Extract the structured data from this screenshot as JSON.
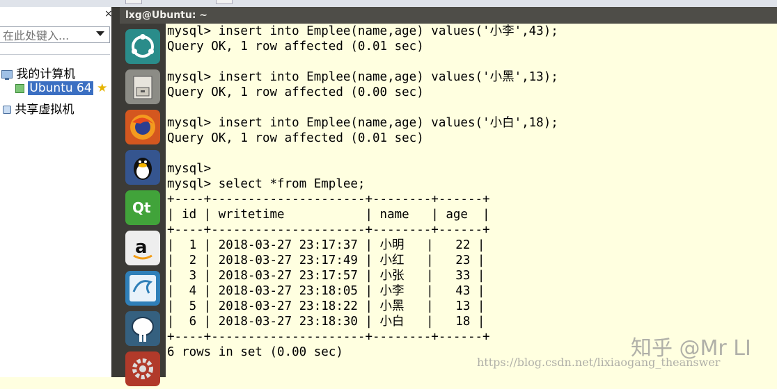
{
  "vm_library": {
    "close_glyph": "×",
    "search_placeholder": "在此处键入...",
    "tree": [
      {
        "label": "我的计算机"
      },
      {
        "label": "Ubuntu 64"
      },
      {
        "label": "共享虚拟机"
      }
    ]
  },
  "terminal": {
    "title": "lxg@Ubuntu: ~",
    "lines": [
      "mysql> insert into Emplee(name,age) values('小李',43);",
      "Query OK, 1 row affected (0.01 sec)",
      "",
      "mysql> insert into Emplee(name,age) values('小黑',13);",
      "Query OK, 1 row affected (0.00 sec)",
      "",
      "mysql> insert into Emplee(name,age) values('小白',18);",
      "Query OK, 1 row affected (0.01 sec)",
      "",
      "mysql>",
      "mysql> select *from Emplee;",
      "+----+---------------------+--------+------+",
      "| id | writetime           | name   | age  |",
      "+----+---------------------+--------+------+",
      "|  1 | 2018-03-27 23:17:37 | 小明   |   22 |",
      "|  2 | 2018-03-27 23:17:49 | 小红   |   23 |",
      "|  3 | 2018-03-27 23:17:57 | 小张   |   33 |",
      "|  4 | 2018-03-27 23:18:05 | 小李   |   43 |",
      "|  5 | 2018-03-27 23:18:22 | 小黑   |   13 |",
      "|  6 | 2018-03-27 23:18:30 | 小白   |   18 |",
      "+----+---------------------+--------+------+",
      "6 rows in set (0.00 sec)"
    ]
  },
  "launcher": [
    {
      "name": "ubuntu-dash-icon",
      "color": "#2a8c8a"
    },
    {
      "name": "file-cabinet-icon",
      "color": "#8c8c86"
    },
    {
      "name": "firefox-icon",
      "color": "#d94f1e"
    },
    {
      "name": "qq-penguin-icon",
      "color": "#2a4f8c"
    },
    {
      "name": "qt-creator-icon",
      "color": "#41a33a"
    },
    {
      "name": "amazon-icon",
      "color": "#e8e8e8"
    },
    {
      "name": "mysql-workbench-icon",
      "color": "#2f7fb8"
    },
    {
      "name": "postgresql-elephant-icon",
      "color": "#35607f"
    },
    {
      "name": "settings-icon",
      "color": "#b13a2a"
    }
  ],
  "watermark": {
    "brand": "知乎 @Mr LI",
    "url": "https://blog.csdn.net/lixiaogang_theanswer"
  }
}
